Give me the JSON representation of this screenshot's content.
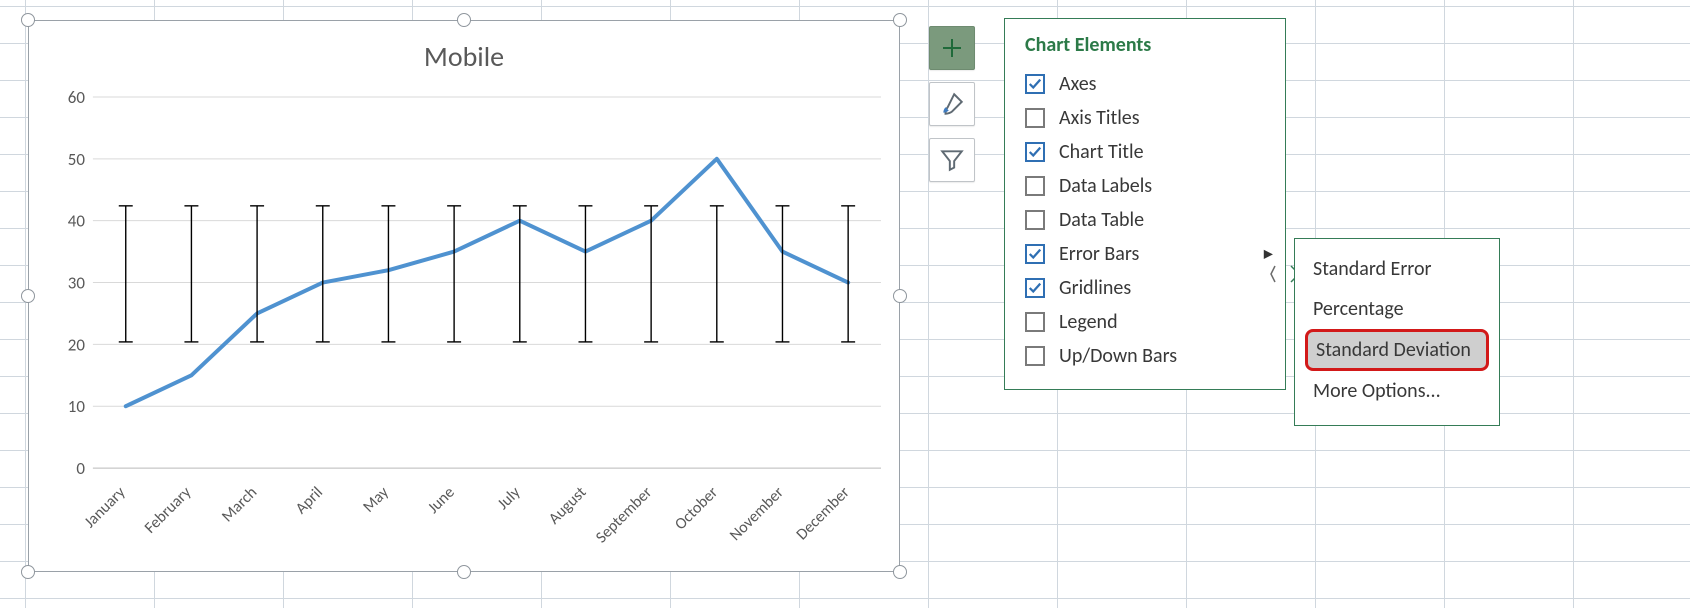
{
  "chart_data": {
    "type": "line",
    "title": "Mobile",
    "categories": [
      "January",
      "February",
      "March",
      "April",
      "May",
      "June",
      "July",
      "August",
      "September",
      "October",
      "November",
      "December"
    ],
    "values": [
      10,
      15,
      25,
      30,
      32,
      35,
      40,
      35,
      40,
      50,
      35,
      30
    ],
    "ylim": [
      0,
      60
    ],
    "yticks": [
      0,
      10,
      20,
      30,
      40,
      50,
      60
    ],
    "error_bars": {
      "center": 31.4,
      "plus": 11,
      "minus": 11
    },
    "xlabel": "",
    "ylabel": "",
    "line_color": "#4f92d0"
  },
  "side_buttons": {
    "plus": "chart-elements-button",
    "brush": "chart-styles-button",
    "filter": "chart-filters-button"
  },
  "panel": {
    "title": "Chart Elements",
    "items": [
      {
        "label": "Axes",
        "checked": true
      },
      {
        "label": "Axis Titles",
        "checked": false
      },
      {
        "label": "Chart Title",
        "checked": true
      },
      {
        "label": "Data Labels",
        "checked": false
      },
      {
        "label": "Data Table",
        "checked": false
      },
      {
        "label": "Error Bars",
        "checked": true,
        "has_sub": true
      },
      {
        "label": "Gridlines",
        "checked": true
      },
      {
        "label": "Legend",
        "checked": false
      },
      {
        "label": "Up/Down Bars",
        "checked": false
      }
    ]
  },
  "submenu": {
    "items": [
      {
        "label": "Standard Error"
      },
      {
        "label": "Percentage"
      },
      {
        "label": "Standard Deviation",
        "highlighted": true
      },
      {
        "label": "More Options..."
      }
    ]
  }
}
